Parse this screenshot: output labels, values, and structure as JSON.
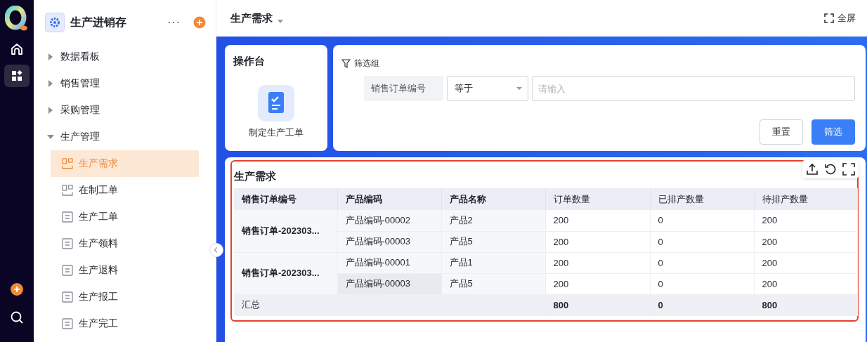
{
  "rail": [
    {
      "kind": "home",
      "selected": false
    },
    {
      "kind": "apps",
      "selected": true
    }
  ],
  "sidebar": {
    "title": "生产进销存",
    "more": "···",
    "items": [
      {
        "label": "数据看板",
        "expanded": false
      },
      {
        "label": "销售管理",
        "expanded": false
      },
      {
        "label": "采购管理",
        "expanded": false
      },
      {
        "label": "生产管理",
        "expanded": true,
        "children": [
          {
            "label": "生产需求",
            "kind": "board",
            "selected": true
          },
          {
            "label": "在制工单",
            "kind": "board",
            "selected": false
          },
          {
            "label": "生产工单",
            "kind": "doc",
            "selected": false
          },
          {
            "label": "生产领料",
            "kind": "doc",
            "selected": false
          },
          {
            "label": "生产退料",
            "kind": "doc",
            "selected": false
          },
          {
            "label": "生产报工",
            "kind": "doc",
            "selected": false
          },
          {
            "label": "生产完工",
            "kind": "doc",
            "selected": false
          }
        ]
      }
    ]
  },
  "header": {
    "title": "生产需求",
    "fullscreen": "全屏"
  },
  "console": {
    "title": "操作台",
    "action": "制定生产工单"
  },
  "filter": {
    "title": "筛选组",
    "field": "销售订单编号",
    "operator": "等于",
    "placeholder": "请输入",
    "buttons": [
      {
        "label": "重置",
        "kind": "default"
      },
      {
        "label": "筛选",
        "kind": "primary"
      }
    ]
  },
  "table": {
    "title": "生产需求",
    "columns": [
      "销售订单编号",
      "产品编码",
      "产品名称",
      "订单数量",
      "已排产数量",
      "待排产数量"
    ],
    "groups": [
      {
        "order": "销售订单-202303...",
        "items": [
          {
            "code": "产品编码-00002",
            "name": "产品2",
            "order_qty": "200",
            "scheduled": "0",
            "pending": "200",
            "highlighted": false
          },
          {
            "code": "产品编码-00003",
            "name": "产品5",
            "order_qty": "200",
            "scheduled": "0",
            "pending": "200",
            "highlighted": false
          }
        ]
      },
      {
        "order": "销售订单-202303...",
        "items": [
          {
            "code": "产品编码-00001",
            "name": "产品1",
            "order_qty": "200",
            "scheduled": "0",
            "pending": "200",
            "highlighted": false
          },
          {
            "code": "产品编码-00003",
            "name": "产品5",
            "order_qty": "200",
            "scheduled": "0",
            "pending": "200",
            "highlighted": true
          }
        ]
      }
    ],
    "summary": {
      "label": "汇总",
      "order_qty": "800",
      "scheduled": "0",
      "pending": "800"
    }
  }
}
